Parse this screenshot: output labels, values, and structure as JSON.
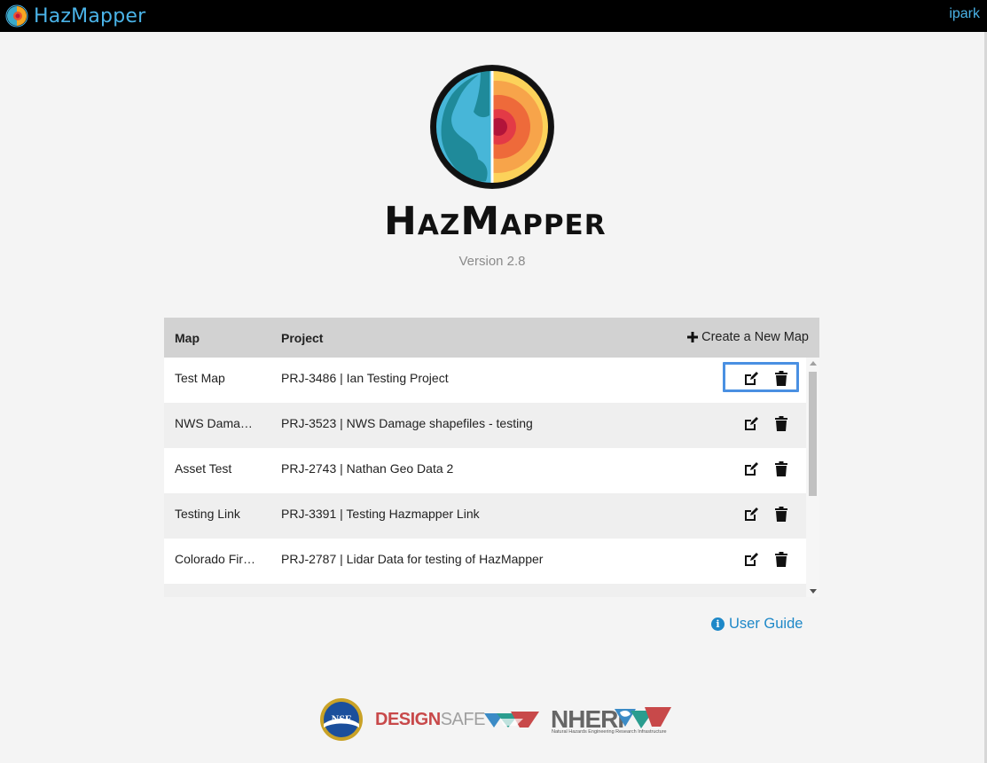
{
  "topbar": {
    "brand": "HazMapper",
    "user": "ipark"
  },
  "hero": {
    "wordmark_H": "H",
    "wordmark_AZ": "AZ",
    "wordmark_M": "M",
    "wordmark_APPER": "APPER",
    "version": "Version 2.8"
  },
  "table": {
    "headers": {
      "map": "Map",
      "project": "Project",
      "create": "Create a New Map"
    },
    "rows": [
      {
        "map": "Test Map",
        "project": "PRJ-3486 | Ian Testing Project"
      },
      {
        "map": "NWS Damage shapefiles",
        "project": "PRJ-3523 | NWS Damage shapefiles - testing"
      },
      {
        "map": "Asset Test",
        "project": "PRJ-2743 | Nathan Geo Data 2"
      },
      {
        "map": "Testing Link",
        "project": "PRJ-3391 | Testing Hazmapper Link"
      },
      {
        "map": "Colorado Fire Lidar",
        "project": "PRJ-2787 | Lidar Data for testing of HazMapper"
      },
      {
        "map": "",
        "project": ""
      }
    ]
  },
  "links": {
    "user_guide": "User Guide"
  },
  "sponsors": {
    "nsf": "NSF",
    "designsafe_a": "DESIGN",
    "designsafe_b": "SAFE",
    "nheri": "NHERI",
    "nheri_sub": "Natural Hazards Engineering Research Infrastructure"
  },
  "colors": {
    "accent": "#4ab3e8",
    "link": "#1e88c8",
    "focus": "#4a90e2",
    "header_bg": "#d2d2d2"
  }
}
